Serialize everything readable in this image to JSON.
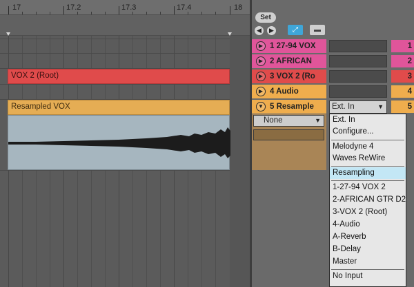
{
  "ruler": {
    "labels": [
      "17",
      "17.2",
      "17.3",
      "17.4",
      "18"
    ]
  },
  "clips": {
    "vox2_name": "VOX 2 (Root)",
    "resampled_name": "Resampled VOX"
  },
  "session": {
    "set_label": "Set",
    "tracks": [
      {
        "label": "1 27-94 VOX",
        "number": "1",
        "color": "#e0559a"
      },
      {
        "label": "2 AFRICAN",
        "number": "2",
        "color": "#e0559a"
      },
      {
        "label": "3 VOX 2 (Ro",
        "number": "3",
        "color": "#e04b4b"
      },
      {
        "label": "4 Audio",
        "number": "4",
        "color": "#efad4d"
      },
      {
        "label": "5 Resample",
        "number": "5",
        "color": "#efad4d"
      }
    ],
    "input_type_value": "Ext. In",
    "input_channel_value": "None"
  },
  "dropdown": {
    "items": [
      "Ext. In",
      "Configure...",
      "Melodyne 4",
      "Waves ReWire",
      "Resampling",
      "1-27-94 VOX 2",
      "2-AFRICAN GTR D2",
      "3-VOX 2 (Root)",
      "4-Audio",
      "A-Reverb",
      "B-Delay",
      "Master",
      "No Input"
    ],
    "highlighted_index": 4
  },
  "colors": {
    "accent_blue": "#3fa6d8",
    "clip_red": "#e04b4b",
    "clip_orange": "#e5ad54",
    "track_pink": "#e0559a"
  }
}
